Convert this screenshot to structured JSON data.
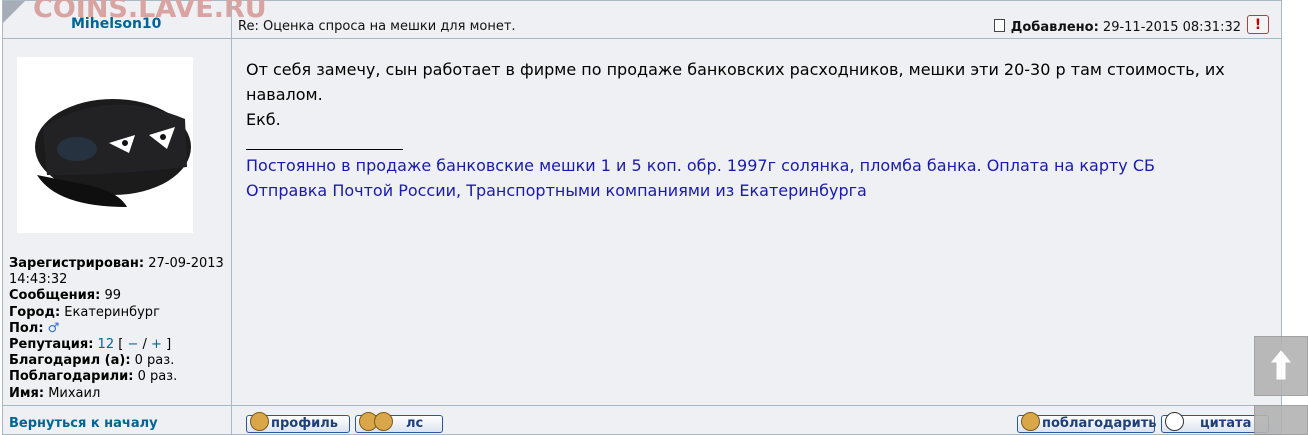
{
  "watermark": "COINS.LAVE.RU",
  "post": {
    "author": "Mihelson10",
    "subject": "Re: Оценка спроса на мешки для монет.",
    "added_label": "Добавлено:",
    "added_date": "29-11-2015 08:31:32",
    "report_label": "!",
    "message_lines": [
      "От себя замечу, сын работает в фирме по продаже банковских расходников, мешки эти 20-30 р там стоимость, их навалом.",
      "Екб."
    ],
    "signature_lines": [
      "Постоянно в продаже банковские мешки 1 и 5 коп. обр. 1997г солянка, пломба банка. Оплата на карту СБ",
      "Отправка Почтой России, Транспортными компаниями из Екатеринбурга"
    ]
  },
  "profile": {
    "registered_label": "Зарегистрирован:",
    "registered_value": "27-09-2013 14:43:32",
    "messages_label": "Сообщения:",
    "messages_value": "99",
    "city_label": "Город:",
    "city_value": "Екатеринбург",
    "gender_label": "Пол:",
    "gender_icon": "male-symbol-icon",
    "reputation_label": "Репутация:",
    "reputation_value": "12",
    "rep_open": "[",
    "rep_minus": "−",
    "rep_sep": "/",
    "rep_plus": "+",
    "rep_close": "]",
    "thanked_label": "Благодарил (а):",
    "thanked_value": "0 раз.",
    "was_thanked_label": "Поблагодарили:",
    "was_thanked_value": "0 раз.",
    "name_label": "Имя:",
    "name_value": "Михаил"
  },
  "footer": {
    "back_to_top": "Вернуться к началу",
    "profile_button": "профиль",
    "pm_button": "лс",
    "thank_button": "поблагодарить",
    "quote_button": "цитата"
  },
  "colors": {
    "link": "#006597",
    "signature": "#1a1ab0",
    "panel": "#eef0f3",
    "border": "#a9b8c2"
  }
}
